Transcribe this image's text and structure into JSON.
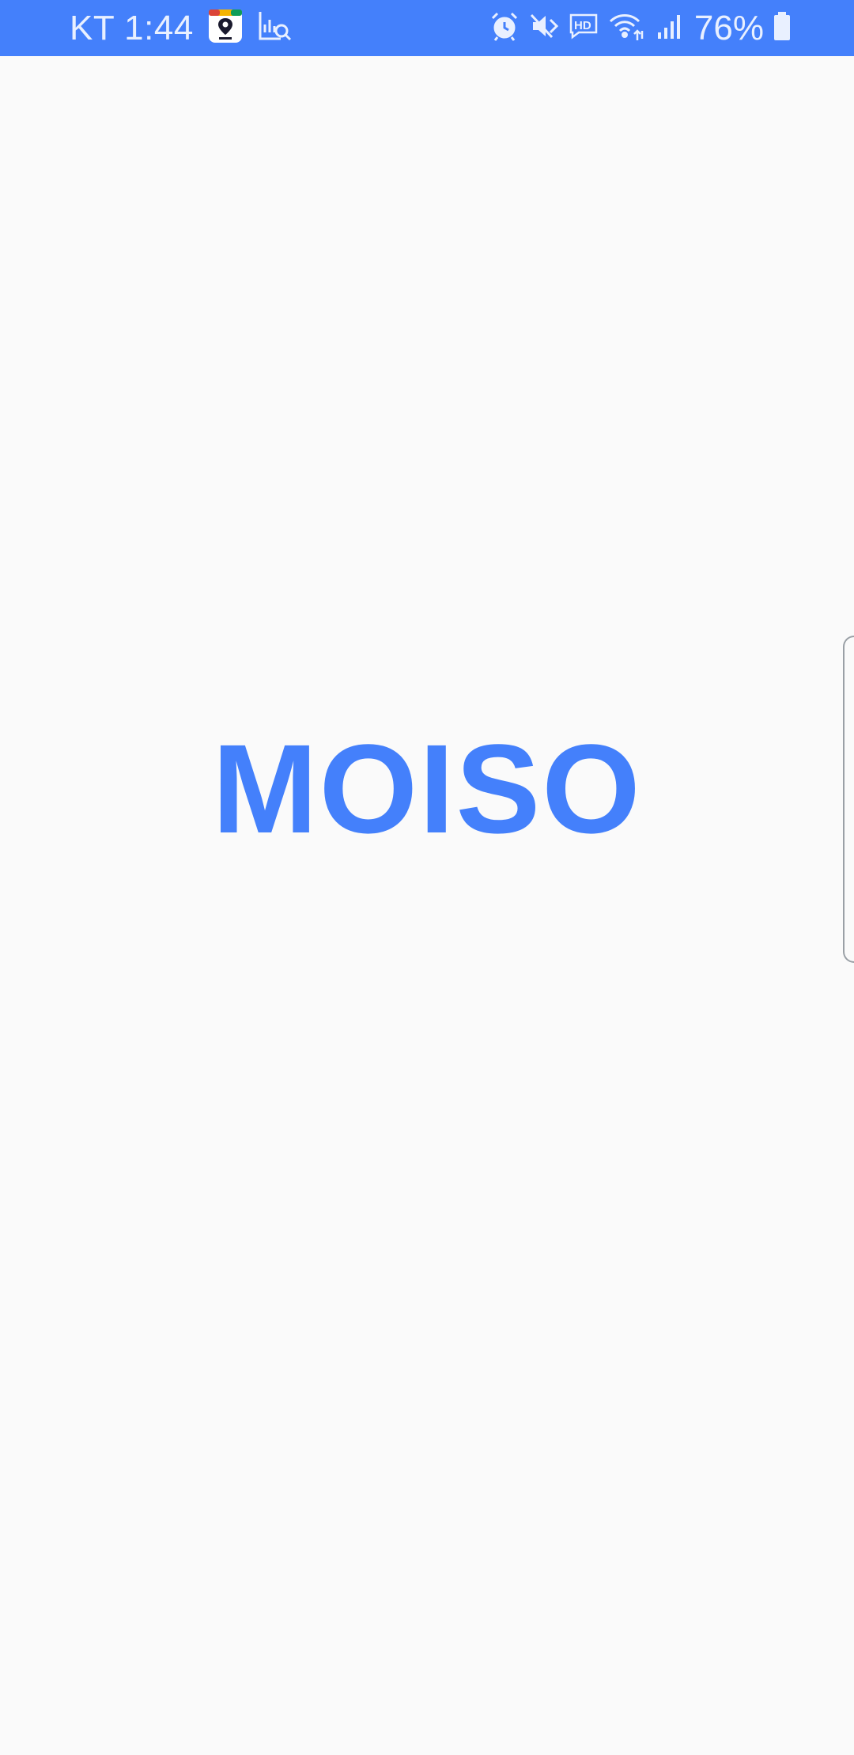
{
  "status_bar": {
    "carrier_time": "KT 1:44",
    "battery_percent": "76%",
    "notification_icons": [
      "maps-app-icon",
      "search-analytics-icon"
    ],
    "system_icons": [
      "alarm-icon",
      "mute-icon",
      "hd-voice-icon",
      "wifi-icon",
      "signal-icon",
      "battery-icon"
    ],
    "background_color": "#4480fb"
  },
  "main": {
    "logo_text": "MOISO",
    "logo_color": "#4480fb",
    "background_color": "#fafafa"
  }
}
